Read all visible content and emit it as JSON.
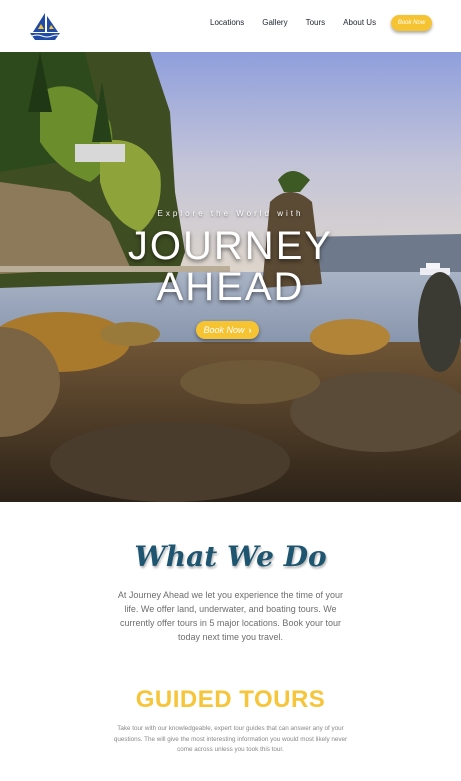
{
  "header": {
    "nav": [
      {
        "label": "Locations"
      },
      {
        "label": "Gallery"
      },
      {
        "label": "Tours"
      },
      {
        "label": "About Us"
      }
    ],
    "cta_label": "Book Now"
  },
  "hero": {
    "tagline": "Explore the World with",
    "title_line1": "JOURNEY",
    "title_line2": "AHEAD",
    "button_label": "Book Now",
    "button_icon": "chevron-right-icon"
  },
  "what_we_do": {
    "title": "What We Do",
    "body": "At Journey Ahead we let you experience the time of your life. We offer land, underwater, and boating tours. We currently offer tours in 5 major locations. Book your tour today next time you travel."
  },
  "guided_tours": {
    "title": "GUIDED TOURS",
    "body": "Take tour with our knowledgeable, expert tour guides that can answer any of your questions. The will give the most interesting information you would most likely never come across unless you took this tour."
  },
  "colors": {
    "accent_yellow": "#f6c432",
    "heading_teal": "#1e5570",
    "logo_blue": "#1f4aa6"
  }
}
